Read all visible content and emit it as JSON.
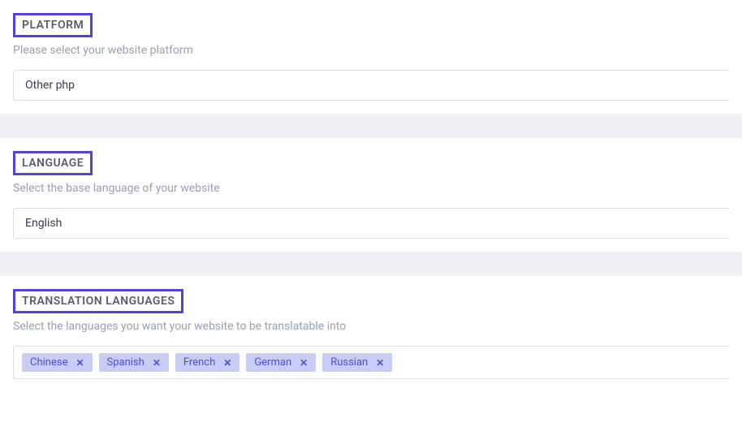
{
  "platform": {
    "title": "PLATFORM",
    "subtitle": "Please select your website platform",
    "value": "Other php"
  },
  "language": {
    "title": "LANGUAGE",
    "subtitle": "Select the base language of your website",
    "value": "English"
  },
  "translation": {
    "title": "TRANSLATION LANGUAGES",
    "subtitle": "Select the languages you want your website to be translatable into",
    "tags": [
      "Chinese",
      "Spanish",
      "French",
      "German",
      "Russian"
    ]
  }
}
